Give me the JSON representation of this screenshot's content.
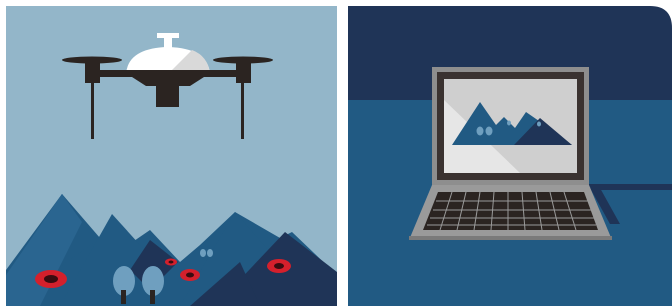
{
  "scene": {
    "left_panel": {
      "subject": "drone-over-mountains",
      "colors": {
        "sky": "#93b6c9",
        "mountain_mid": "#215a83",
        "mountain_dark": "#1f3457",
        "drone_body": "#2b2421",
        "dome": "#ffffff",
        "target_red": "#d4202c"
      }
    },
    "right_panel": {
      "subject": "laptop-showing-drone-photo",
      "colors": {
        "wall": "#1f3457",
        "desk": "#215a83",
        "laptop_body": "#9a9a9a",
        "screen_bezel": "#3a3230",
        "screen_bg": "#e6e6e6"
      }
    }
  }
}
